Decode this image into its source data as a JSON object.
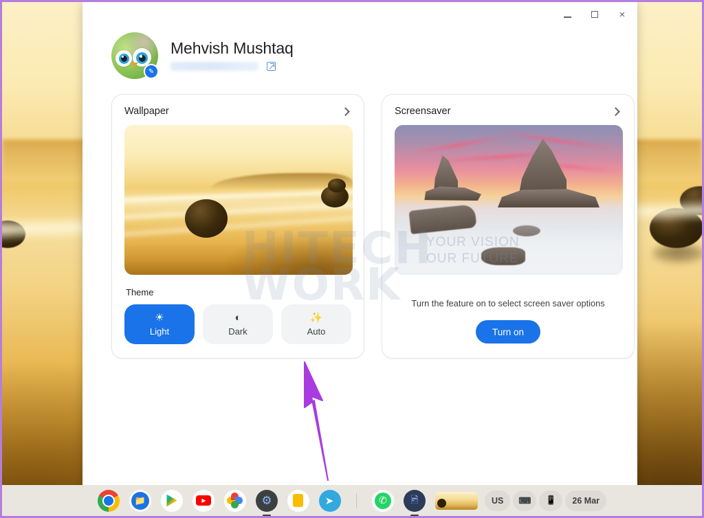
{
  "window": {
    "controls": {
      "minimize_label": "–",
      "maximize_label": "□",
      "close_label": "×"
    }
  },
  "profile": {
    "name": "Mehvish Mushtaq",
    "email_redacted": "",
    "external_link_icon": "external-link-icon",
    "edit_badge_icon": "pencil-icon"
  },
  "wallpaper_card": {
    "title": "Wallpaper",
    "chevron_icon": "chevron-right-icon"
  },
  "screensaver_card": {
    "title": "Screensaver",
    "chevron_icon": "chevron-right-icon",
    "note": "Turn the feature on to select screen saver options",
    "button_label": "Turn on"
  },
  "theme": {
    "label": "Theme",
    "options": [
      {
        "label": "Light",
        "icon": "sun-icon",
        "selected": true
      },
      {
        "label": "Dark",
        "icon": "half-moon-icon",
        "selected": false
      },
      {
        "label": "Auto",
        "icon": "magic-wand-icon",
        "selected": false
      }
    ]
  },
  "shelf": {
    "apps": [
      {
        "name": "chrome",
        "label": "Chrome"
      },
      {
        "name": "files",
        "label": "Files"
      },
      {
        "name": "play-store",
        "label": "Play Store"
      },
      {
        "name": "youtube",
        "label": "YouTube"
      },
      {
        "name": "google-photos",
        "label": "Google Photos"
      },
      {
        "name": "settings",
        "label": "Settings"
      },
      {
        "name": "keep",
        "label": "Keep"
      },
      {
        "name": "telegram",
        "label": "Telegram"
      },
      {
        "name": "whatsapp",
        "label": "WhatsApp"
      },
      {
        "name": "gallery",
        "label": "Gallery"
      },
      {
        "name": "wallpaper-thumbnail",
        "label": "Wallpaper"
      }
    ],
    "tray": {
      "keyboard_layout": "US",
      "keyboard_icon": "keyboard-icon",
      "device_icon": "phone-icon",
      "clock": "26 Mar"
    }
  },
  "watermark": {
    "line1": "HITECH",
    "line2": "WORK",
    "tagline1": "YOUR VISION",
    "tagline2": "OUR FUTURE"
  },
  "annotation": {
    "arrow_color": "#a93be0",
    "points_to": "Auto"
  },
  "colors": {
    "accent_blue": "#1a73e8",
    "button_gray": "#f1f3f4",
    "text_primary": "#202124",
    "text_secondary": "#3c4043",
    "shelf_bg": "#e9e6e0",
    "border_purple": "#b57edc"
  }
}
